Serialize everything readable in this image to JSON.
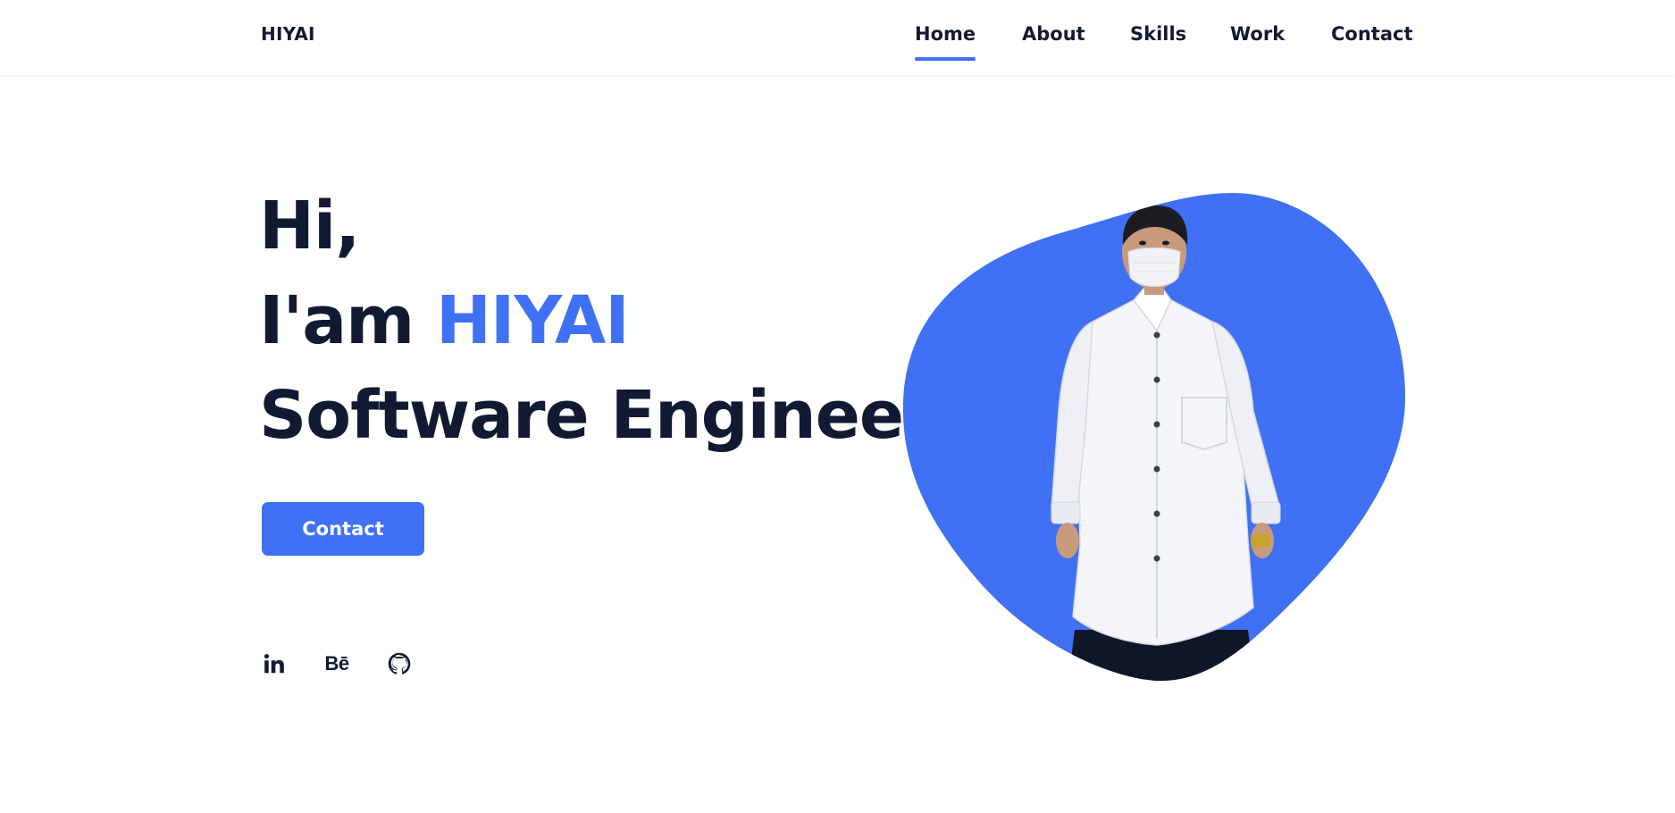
{
  "header": {
    "logo": "HIYAI",
    "nav": [
      {
        "label": "Home",
        "active": true
      },
      {
        "label": "About",
        "active": false
      },
      {
        "label": "Skills",
        "active": false
      },
      {
        "label": "Work",
        "active": false
      },
      {
        "label": "Contact",
        "active": false
      }
    ]
  },
  "hero": {
    "greeting": "Hi,",
    "intro_prefix": "I'am",
    "name": "HIYAI",
    "role": "Software Engineer",
    "button_label": "Contact"
  },
  "social": [
    {
      "name": "LinkedIn",
      "glyph": "in",
      "icon": "linkedin-icon"
    },
    {
      "name": "Behance",
      "glyph": "Bē",
      "icon": "behance-icon"
    },
    {
      "name": "GitHub",
      "icon": "github-icon"
    }
  ],
  "colors": {
    "accent": "#4070f4",
    "text": "#121a33",
    "background": "#ffffff"
  }
}
